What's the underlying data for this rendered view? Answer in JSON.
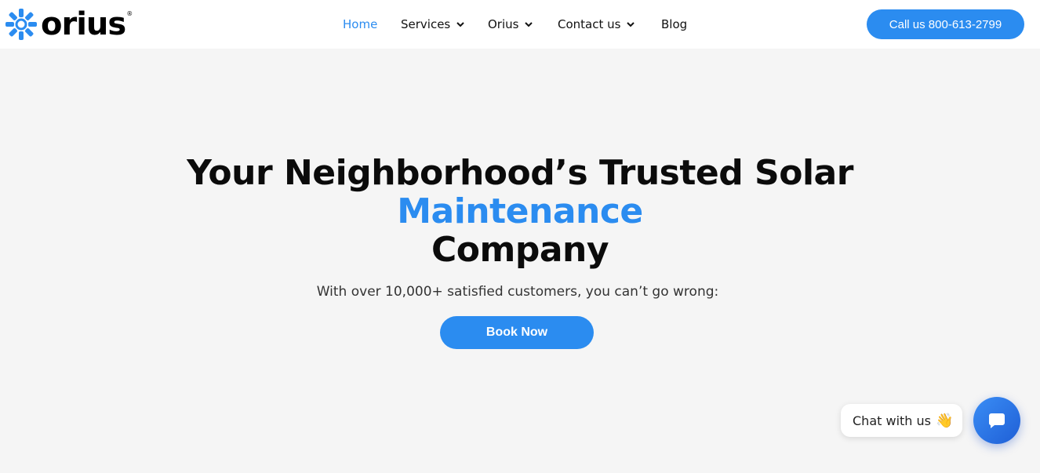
{
  "header": {
    "logo_text": "orius",
    "logo_reg": "®",
    "nav": [
      {
        "label": "Home",
        "active": true,
        "has_dropdown": false
      },
      {
        "label": "Services",
        "active": false,
        "has_dropdown": true
      },
      {
        "label": "Orius",
        "active": false,
        "has_dropdown": true
      },
      {
        "label": "Contact us",
        "active": false,
        "has_dropdown": true
      },
      {
        "label": "Blog",
        "active": false,
        "has_dropdown": false
      }
    ],
    "call_label": "Call us 800-613-2799"
  },
  "hero": {
    "title_line1": "Your Neighborhood’s Trusted Solar",
    "title_line2": "Maintenance",
    "title_line3": "Company",
    "subtitle": "With over 10,000+ satisfied customers, you can’t go wrong:",
    "cta_label": "Book Now"
  },
  "chat": {
    "bubble_label": "Chat with us",
    "bubble_emoji": "👋",
    "launcher_icon": "chat-bubble-icon"
  },
  "colors": {
    "accent": "#2b8cf0",
    "page_bg": "#f5f5f5",
    "header_bg": "#ffffff",
    "text": "#0b0b0b"
  }
}
